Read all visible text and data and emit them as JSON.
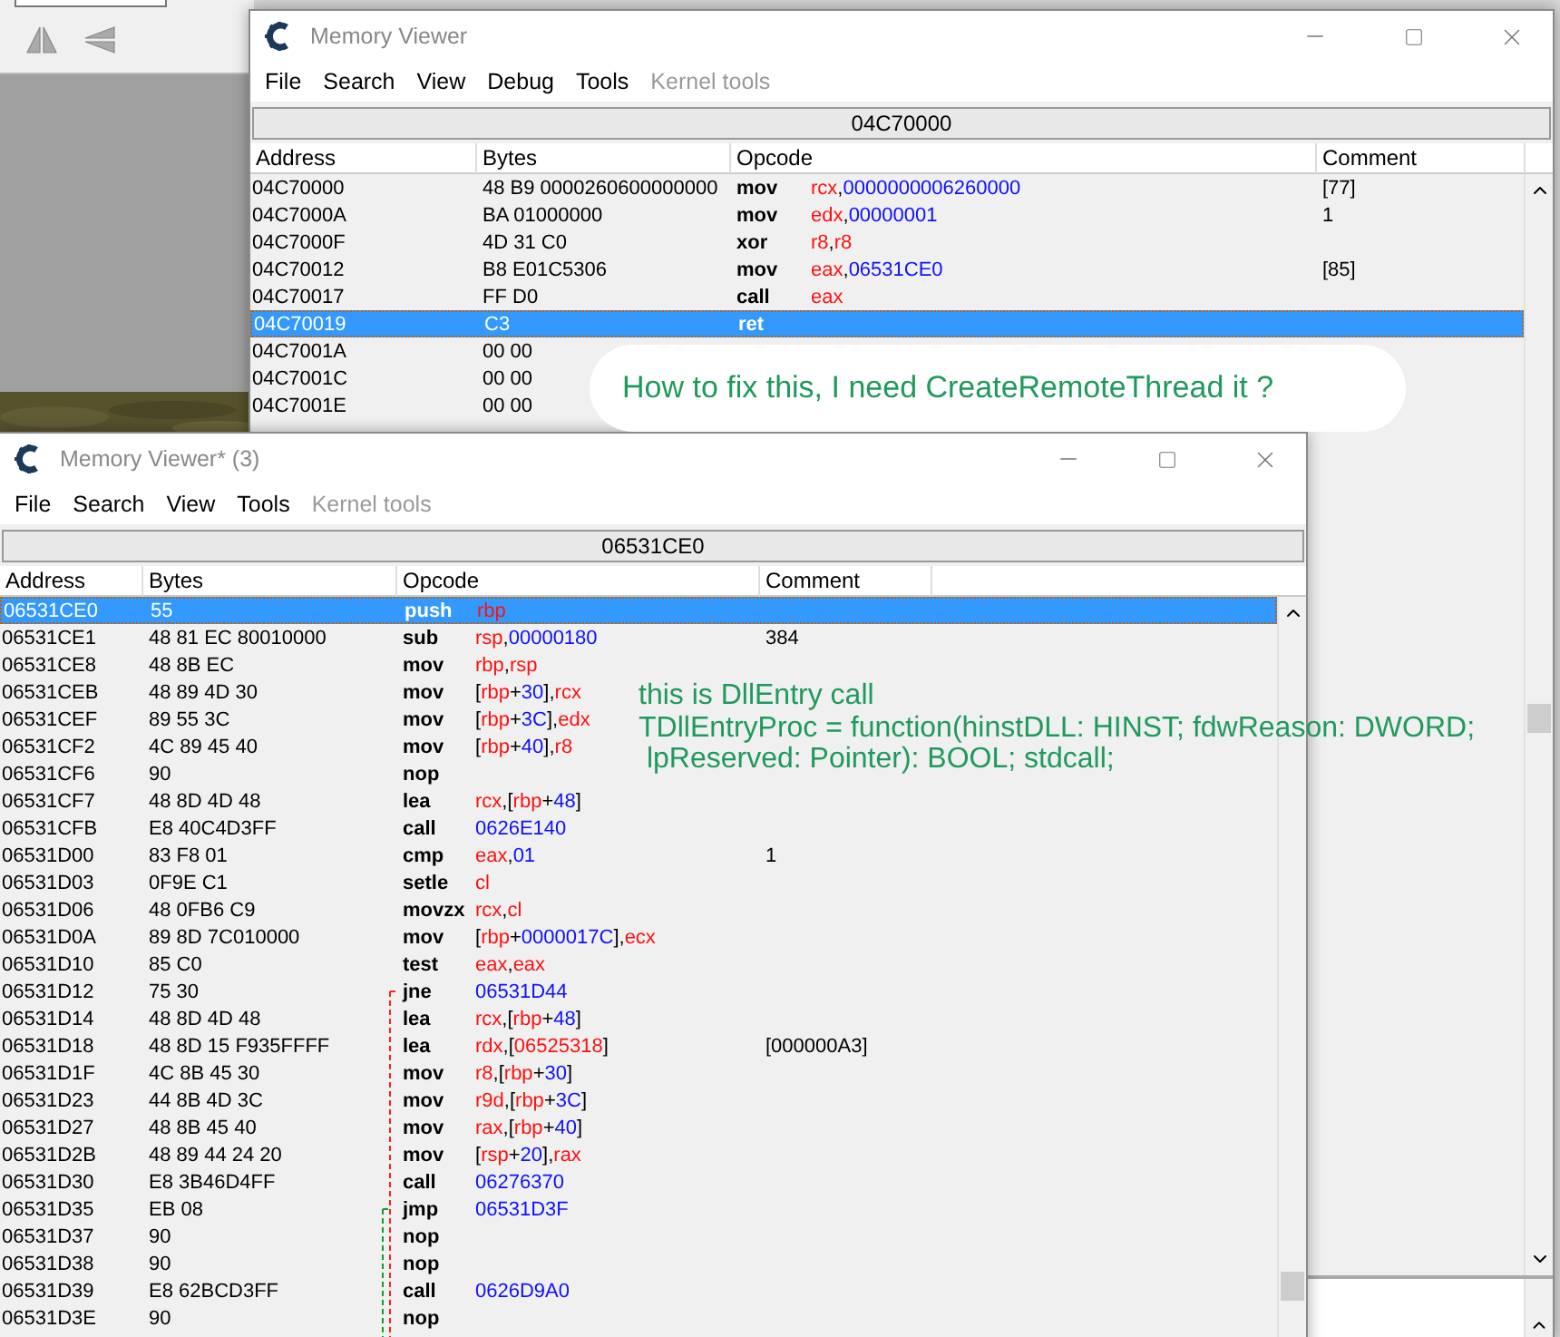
{
  "windows": [
    {
      "title": "Memory Viewer",
      "menu": [
        {
          "label": "File",
          "disabled": false
        },
        {
          "label": "Search",
          "disabled": false
        },
        {
          "label": "View",
          "disabled": false
        },
        {
          "label": "Debug",
          "disabled": false
        },
        {
          "label": "Tools",
          "disabled": false
        },
        {
          "label": "Kernel tools",
          "disabled": true
        }
      ],
      "address": "04C70000",
      "columns": [
        "Address",
        "Bytes",
        "Opcode",
        "Comment"
      ],
      "rows": [
        {
          "address": "04C70000",
          "bytes": "48 B9 0000260600000000",
          "mnemonic": "mov",
          "operand": [
            {
              "kind": "reg",
              "text": "rcx"
            },
            {
              "kind": "punct",
              "text": ","
            },
            {
              "kind": "num",
              "text": "0000000006260000"
            }
          ],
          "comment": "[77]",
          "selected": false
        },
        {
          "address": "04C7000A",
          "bytes": "BA 01000000",
          "mnemonic": "mov",
          "operand": [
            {
              "kind": "reg",
              "text": "edx"
            },
            {
              "kind": "punct",
              "text": ","
            },
            {
              "kind": "num",
              "text": "00000001"
            }
          ],
          "comment": "1",
          "selected": false
        },
        {
          "address": "04C7000F",
          "bytes": "4D 31 C0",
          "mnemonic": "xor",
          "operand": [
            {
              "kind": "reg",
              "text": "r8"
            },
            {
              "kind": "punct",
              "text": ","
            },
            {
              "kind": "reg",
              "text": "r8"
            }
          ],
          "selected": false
        },
        {
          "address": "04C70012",
          "bytes": "B8 E01C5306",
          "mnemonic": "mov",
          "operand": [
            {
              "kind": "reg",
              "text": "eax"
            },
            {
              "kind": "punct",
              "text": ","
            },
            {
              "kind": "num",
              "text": "06531CE0"
            }
          ],
          "comment": "[85]",
          "selected": false
        },
        {
          "address": "04C70017",
          "bytes": "FF D0",
          "mnemonic": "call",
          "operand": [
            {
              "kind": "reg",
              "text": "eax"
            }
          ],
          "selected": false
        },
        {
          "address": "04C70019",
          "bytes": "C3",
          "mnemonic": "ret",
          "selected": true
        },
        {
          "address": "04C7001A",
          "bytes": "00 00",
          "selected": false
        },
        {
          "address": "04C7001C",
          "bytes": "00 00",
          "selected": false
        },
        {
          "address": "04C7001E",
          "bytes": "00 00",
          "selected": false
        }
      ]
    },
    {
      "title": "Memory Viewer* (3)",
      "menu": [
        {
          "label": "File",
          "disabled": false
        },
        {
          "label": "Search",
          "disabled": false
        },
        {
          "label": "View",
          "disabled": false
        },
        {
          "label": "Tools",
          "disabled": false
        },
        {
          "label": "Kernel tools",
          "disabled": true
        }
      ],
      "address": "06531CE0",
      "columns": [
        "Address",
        "Bytes",
        "Opcode",
        "Comment"
      ],
      "rows": [
        {
          "address": "06531CE0",
          "bytes": "55",
          "mnemonic": "push",
          "operand": [
            {
              "kind": "reg",
              "text": "rbp"
            }
          ],
          "selected": true
        },
        {
          "address": "06531CE1",
          "bytes": "48 81 EC 80010000",
          "mnemonic": "sub",
          "operand": [
            {
              "kind": "reg",
              "text": "rsp"
            },
            {
              "kind": "punct",
              "text": ","
            },
            {
              "kind": "num",
              "text": "00000180"
            }
          ],
          "comment": "384",
          "selected": false
        },
        {
          "address": "06531CE8",
          "bytes": "48 8B EC",
          "mnemonic": "mov",
          "operand": [
            {
              "kind": "reg",
              "text": "rbp"
            },
            {
              "kind": "punct",
              "text": ","
            },
            {
              "kind": "reg",
              "text": "rsp"
            }
          ],
          "selected": false
        },
        {
          "address": "06531CEB",
          "bytes": "48 89 4D 30",
          "mnemonic": "mov",
          "operand": [
            {
              "kind": "punct",
              "text": "["
            },
            {
              "kind": "reg",
              "text": "rbp"
            },
            {
              "kind": "punct",
              "text": "+"
            },
            {
              "kind": "num",
              "text": "30"
            },
            {
              "kind": "punct",
              "text": "],"
            },
            {
              "kind": "reg",
              "text": "rcx"
            }
          ],
          "selected": false
        },
        {
          "address": "06531CEF",
          "bytes": "89 55 3C",
          "mnemonic": "mov",
          "operand": [
            {
              "kind": "punct",
              "text": "["
            },
            {
              "kind": "reg",
              "text": "rbp"
            },
            {
              "kind": "punct",
              "text": "+"
            },
            {
              "kind": "num",
              "text": "3C"
            },
            {
              "kind": "punct",
              "text": "],"
            },
            {
              "kind": "reg",
              "text": "edx"
            }
          ],
          "selected": false
        },
        {
          "address": "06531CF2",
          "bytes": "4C 89 45 40",
          "mnemonic": "mov",
          "operand": [
            {
              "kind": "punct",
              "text": "["
            },
            {
              "kind": "reg",
              "text": "rbp"
            },
            {
              "kind": "punct",
              "text": "+"
            },
            {
              "kind": "num",
              "text": "40"
            },
            {
              "kind": "punct",
              "text": "],"
            },
            {
              "kind": "reg",
              "text": "r8"
            }
          ],
          "selected": false
        },
        {
          "address": "06531CF6",
          "bytes": "90",
          "mnemonic": "nop",
          "selected": false
        },
        {
          "address": "06531CF7",
          "bytes": "48 8D 4D 48",
          "mnemonic": "lea",
          "operand": [
            {
              "kind": "reg",
              "text": "rcx"
            },
            {
              "kind": "punct",
              "text": ",["
            },
            {
              "kind": "reg",
              "text": "rbp"
            },
            {
              "kind": "punct",
              "text": "+"
            },
            {
              "kind": "num",
              "text": "48"
            },
            {
              "kind": "punct",
              "text": "]"
            }
          ],
          "selected": false
        },
        {
          "address": "06531CFB",
          "bytes": "E8 40C4D3FF",
          "mnemonic": "call",
          "operand": [
            {
              "kind": "num",
              "text": "0626E140"
            }
          ],
          "selected": false
        },
        {
          "address": "06531D00",
          "bytes": "83 F8 01",
          "mnemonic": "cmp",
          "operand": [
            {
              "kind": "reg",
              "text": "eax"
            },
            {
              "kind": "punct",
              "text": ","
            },
            {
              "kind": "num",
              "text": "01"
            }
          ],
          "comment": "1",
          "selected": false
        },
        {
          "address": "06531D03",
          "bytes": "0F9E C1",
          "mnemonic": "setle",
          "operand": [
            {
              "kind": "reg",
              "text": "cl"
            }
          ],
          "selected": false
        },
        {
          "address": "06531D06",
          "bytes": "48 0FB6 C9",
          "mnemonic": "movzx",
          "operand": [
            {
              "kind": "reg",
              "text": "rcx"
            },
            {
              "kind": "punct",
              "text": ","
            },
            {
              "kind": "reg",
              "text": "cl"
            }
          ],
          "selected": false
        },
        {
          "address": "06531D0A",
          "bytes": "89 8D 7C010000",
          "mnemonic": "mov",
          "operand": [
            {
              "kind": "punct",
              "text": "["
            },
            {
              "kind": "reg",
              "text": "rbp"
            },
            {
              "kind": "punct",
              "text": "+"
            },
            {
              "kind": "num",
              "text": "0000017C"
            },
            {
              "kind": "punct",
              "text": "],"
            },
            {
              "kind": "reg",
              "text": "ecx"
            }
          ],
          "selected": false
        },
        {
          "address": "06531D10",
          "bytes": "85 C0",
          "mnemonic": "test",
          "operand": [
            {
              "kind": "reg",
              "text": "eax"
            },
            {
              "kind": "punct",
              "text": ","
            },
            {
              "kind": "reg",
              "text": "eax"
            }
          ],
          "selected": false
        },
        {
          "address": "06531D12",
          "bytes": "75 30",
          "mnemonic": "jne",
          "operand": [
            {
              "kind": "num",
              "text": "06531D44"
            }
          ],
          "branch": {
            "color": "#ff2020"
          },
          "selected": false
        },
        {
          "address": "06531D14",
          "bytes": "48 8D 4D 48",
          "mnemonic": "lea",
          "operand": [
            {
              "kind": "reg",
              "text": "rcx"
            },
            {
              "kind": "punct",
              "text": ",["
            },
            {
              "kind": "reg",
              "text": "rbp"
            },
            {
              "kind": "punct",
              "text": "+"
            },
            {
              "kind": "num",
              "text": "48"
            },
            {
              "kind": "punct",
              "text": "]"
            }
          ],
          "selected": false
        },
        {
          "address": "06531D18",
          "bytes": "48 8D 15 F935FFFF",
          "mnemonic": "lea",
          "operand": [
            {
              "kind": "reg",
              "text": "rdx"
            },
            {
              "kind": "punct",
              "text": ",["
            },
            {
              "kind": "reg",
              "text": "06525318"
            },
            {
              "kind": "punct",
              "text": "]"
            }
          ],
          "comment": "[000000A3]",
          "selected": false
        },
        {
          "address": "06531D1F",
          "bytes": "4C 8B 45 30",
          "mnemonic": "mov",
          "operand": [
            {
              "kind": "reg",
              "text": "r8"
            },
            {
              "kind": "punct",
              "text": ",["
            },
            {
              "kind": "reg",
              "text": "rbp"
            },
            {
              "kind": "punct",
              "text": "+"
            },
            {
              "kind": "num",
              "text": "30"
            },
            {
              "kind": "punct",
              "text": "]"
            }
          ],
          "selected": false
        },
        {
          "address": "06531D23",
          "bytes": "44 8B 4D 3C",
          "mnemonic": "mov",
          "operand": [
            {
              "kind": "reg",
              "text": "r9d"
            },
            {
              "kind": "punct",
              "text": ",["
            },
            {
              "kind": "reg",
              "text": "rbp"
            },
            {
              "kind": "punct",
              "text": "+"
            },
            {
              "kind": "num",
              "text": "3C"
            },
            {
              "kind": "punct",
              "text": "]"
            }
          ],
          "selected": false
        },
        {
          "address": "06531D27",
          "bytes": "48 8B 45 40",
          "mnemonic": "mov",
          "operand": [
            {
              "kind": "reg",
              "text": "rax"
            },
            {
              "kind": "punct",
              "text": ",["
            },
            {
              "kind": "reg",
              "text": "rbp"
            },
            {
              "kind": "punct",
              "text": "+"
            },
            {
              "kind": "num",
              "text": "40"
            },
            {
              "kind": "punct",
              "text": "]"
            }
          ],
          "selected": false
        },
        {
          "address": "06531D2B",
          "bytes": "48 89 44 24 20",
          "mnemonic": "mov",
          "operand": [
            {
              "kind": "punct",
              "text": "["
            },
            {
              "kind": "reg",
              "text": "rsp"
            },
            {
              "kind": "punct",
              "text": "+"
            },
            {
              "kind": "num",
              "text": "20"
            },
            {
              "kind": "punct",
              "text": "],"
            },
            {
              "kind": "reg",
              "text": "rax"
            }
          ],
          "selected": false
        },
        {
          "address": "06531D30",
          "bytes": "E8 3B46D4FF",
          "mnemonic": "call",
          "operand": [
            {
              "kind": "num",
              "text": "06276370"
            }
          ],
          "selected": false
        },
        {
          "address": "06531D35",
          "bytes": "EB 08",
          "mnemonic": "jmp",
          "operand": [
            {
              "kind": "num",
              "text": "06531D3F"
            }
          ],
          "branch": {
            "color": "#10a020"
          },
          "selected": false
        },
        {
          "address": "06531D37",
          "bytes": "90",
          "mnemonic": "nop",
          "selected": false
        },
        {
          "address": "06531D38",
          "bytes": "90",
          "mnemonic": "nop",
          "selected": false
        },
        {
          "address": "06531D39",
          "bytes": "E8 62BCD3FF",
          "mnemonic": "call",
          "operand": [
            {
              "kind": "num",
              "text": "0626D9A0"
            }
          ],
          "selected": false
        },
        {
          "address": "06531D3E",
          "bytes": "90",
          "mnemonic": "nop",
          "selected": false
        }
      ]
    }
  ],
  "annotations": [
    {
      "kind": "bubble",
      "lines": [
        "How to fix this, I need CreateRemoteThread it ?"
      ]
    },
    {
      "kind": "note",
      "lines": [
        "this is DllEntry call",
        "TDllEntryProc = function(hinstDLL: HINST; fdwReason: DWORD;",
        " lpReserved: Pointer): BOOL; stdcall;"
      ]
    }
  ]
}
